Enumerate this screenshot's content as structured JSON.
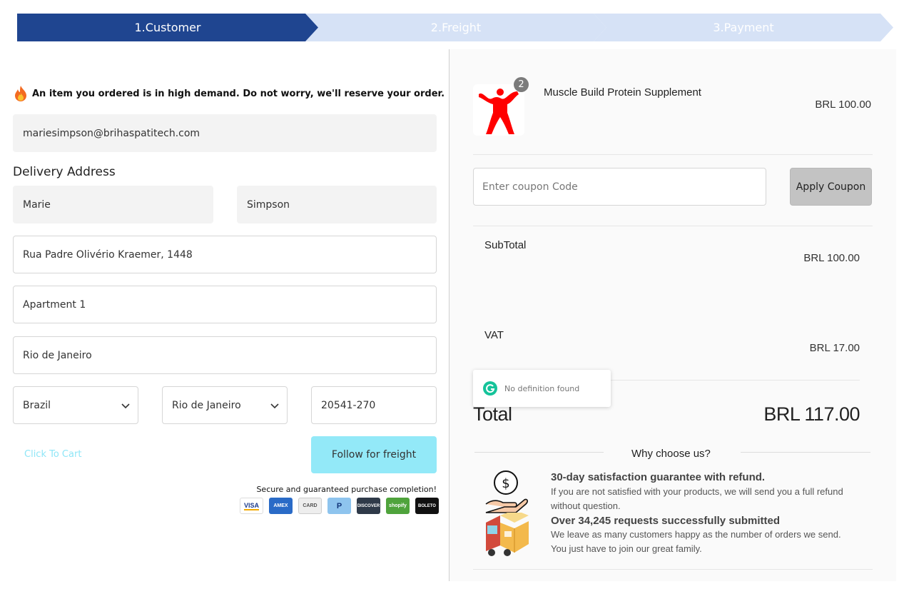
{
  "steps": [
    {
      "label": "1.Customer"
    },
    {
      "label": "2.Freight"
    },
    {
      "label": "3.Payment"
    }
  ],
  "customer": {
    "demand_notice": "An item you ordered is in high demand. Do not worry, we'll reserve your order.",
    "email": "mariesimpson@brihaspatitech.com",
    "delivery_title": "Delivery Address",
    "first_name": "Marie",
    "last_name": "Simpson",
    "address": "Rua Padre Olivério Kraemer, 1448",
    "address2": "Apartment 1",
    "city": "Rio de Janeiro",
    "country": "Brazil",
    "state": "Rio de Janeiro",
    "zip": "20541-270",
    "cart_link": "Click To Cart",
    "freight_button": "Follow for freight",
    "secure_text": "Secure and guaranteed purchase completion!",
    "payment_methods": [
      "VISA",
      "AMEX",
      "CARD",
      "P",
      "DISCOVER",
      "shopify",
      "BOLETO"
    ]
  },
  "order": {
    "product": {
      "name": "Muscle Build Protein Supplement",
      "price": "BRL 100.00",
      "quantity": "2"
    },
    "coupon_placeholder": "Enter coupon Code",
    "coupon_button": "Apply Coupon",
    "subtotal_label": "SubTotal",
    "subtotal_value": "BRL 100.00",
    "vat_label": "VAT",
    "vat_value": "BRL 17.00",
    "total_label": "Total",
    "total_value": "BRL 117.00",
    "tooltip": "No definition found",
    "why_title": "Why choose us?",
    "features": [
      {
        "title": "30-day satisfaction guarantee with refund.",
        "desc": "If you are not satisfied with your products, we will send you a full refund without question."
      },
      {
        "title": "Over 34,245 requests successfully submitted",
        "desc": "We leave as many customers happy as the number of orders we send. You just have to join our great family."
      }
    ]
  },
  "colors": {
    "step_active": "#1f4590",
    "step_inactive": "#d6e2f6",
    "freight_button": "#93e9f8",
    "cart_link": "#8fe6f7",
    "coupon_button": "#c3c3c3"
  }
}
